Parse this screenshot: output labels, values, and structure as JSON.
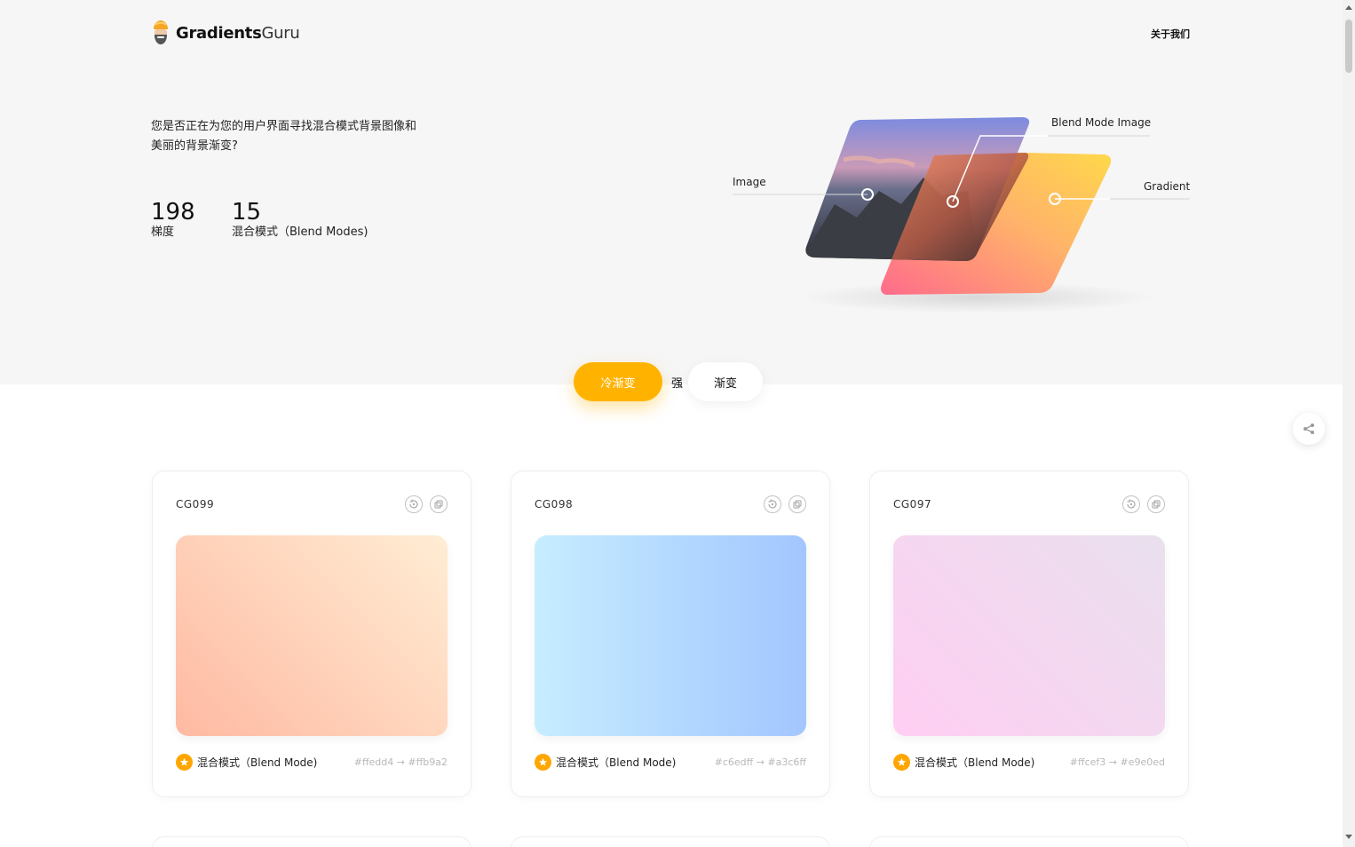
{
  "header": {
    "logo_main": "Gradients",
    "logo_guru": "Guru",
    "nav_about": "关于我们"
  },
  "hero": {
    "tagline": "您是否正在为您的用户界面寻找混合模式背景图像和美丽的背景渐变?",
    "stats": [
      {
        "value": "198",
        "label": "梯度"
      },
      {
        "value": "15",
        "label": "混合模式（Blend Modes)"
      }
    ],
    "illustration_labels": {
      "image": "Image",
      "blend_mode_image": "Blend Mode Image",
      "gradient": "Gradient"
    }
  },
  "tabs": {
    "active": "冷渐变",
    "middle": "强",
    "inactive": "渐变"
  },
  "cards": [
    {
      "id": "CG099",
      "blend_label": "混合模式（Blend Mode)",
      "color_from": "#ffedd4",
      "color_to": "#ffb9a2",
      "gradient_text": "#ffedd4 → #ffb9a2"
    },
    {
      "id": "CG098",
      "blend_label": "混合模式（Blend Mode)",
      "color_from": "#c6edff",
      "color_to": "#a3c6ff",
      "gradient_text": "#c6edff → #a3c6ff"
    },
    {
      "id": "CG097",
      "blend_label": "混合模式（Blend Mode)",
      "color_from": "#ffcef3",
      "color_to": "#e9e0ed",
      "gradient_text": "#ffcef3 → #e9e0ed"
    }
  ],
  "colors": {
    "accent": "#ffb300",
    "star": "#ffa600",
    "hero_bg": "#f6f6f6"
  },
  "icons": {
    "logo": "guru-logo-icon",
    "refresh": "rotate-icon",
    "copy": "copy-icon",
    "star": "star-icon",
    "share": "share-icon"
  }
}
